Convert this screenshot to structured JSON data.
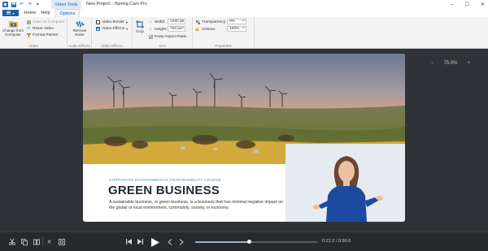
{
  "titlebar": {
    "contextual_tab": "Video Tools",
    "title": "New Project - iSpring Cam Pro",
    "min": "–",
    "max": "☐",
    "close": "✕"
  },
  "tabs": {
    "file": "▾",
    "home": "Home",
    "help": "Help",
    "options": "Options"
  },
  "ribbon": {
    "video": {
      "change_from_computer": "Change from Computer",
      "save_as_computer": "Save as Computer",
      "reset_video": "Reset Video",
      "format_painter": "Format Painter",
      "label": "Video"
    },
    "audio_effects": {
      "remove_noise": "Remove Noise",
      "label": "Audio Effects"
    },
    "video_effects": {
      "video_border": "Video Border",
      "video_effects": "Video Effects",
      "label": "Video Effects"
    },
    "size": {
      "crop": "Crop",
      "width_label": "Width:",
      "width_value": "1280 px",
      "height_label": "Height:",
      "height_value": "720 px",
      "keep_aspect": "Keep Aspect Ratio",
      "label": "Size"
    },
    "properties": {
      "transparency_label": "Transparency:",
      "transparency_value": "0%",
      "volume_label": "Volume:",
      "volume_value": "100%",
      "label": "Properties"
    }
  },
  "canvas": {
    "zoom_out": "−",
    "zoom_level": "75.0%",
    "zoom_in": "+"
  },
  "slide": {
    "course": "CORPORATE ENVIRONMENTAL RESPONSIBILITY COURSE",
    "headline": "GREEN BUSINESS",
    "body": "A sustainable business, or green business, is a business that has minimal negative impact on the global or local environment, community, society, or economy."
  },
  "player": {
    "progress": 0.44,
    "timecode": "0:21.2 / 0:50.0"
  },
  "colors": {
    "accent": "#1e5fa8",
    "canvas_bg": "#2f3236",
    "headline": "#1d2a3a",
    "course": "#3f94c9"
  }
}
